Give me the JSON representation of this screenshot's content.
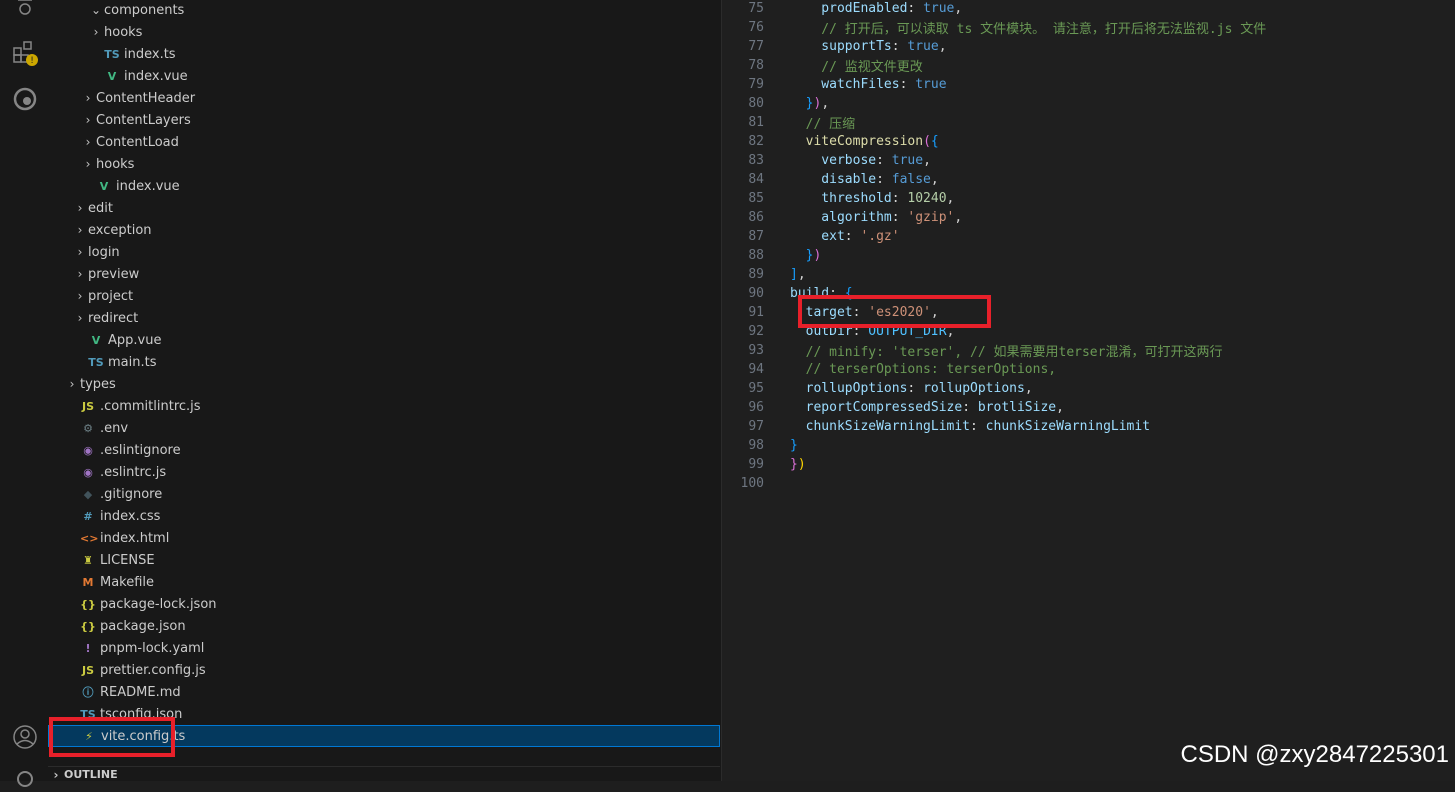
{
  "colors": {
    "keyword": "#9cdcfe",
    "boolean": "#569cd6",
    "string": "#ce9178",
    "number": "#b5cea8",
    "comment": "#6a9955",
    "function": "#dcdcaa",
    "bracket_gold": "#ffd700",
    "bracket_pink": "#da70d6",
    "bracket_blue": "#179fff",
    "variable": "#4fc1ff",
    "plain": "#d4d4d4",
    "highlight": "#e8202a"
  },
  "activity_bar": {
    "icons": [
      "debug-icon",
      "extensions-icon",
      "edge-browser-icon",
      "account-icon",
      "settings-icon"
    ]
  },
  "explorer": {
    "items": [
      {
        "label": "components",
        "chevron": "⌄",
        "icon": "",
        "indent": 4
      },
      {
        "label": "hooks",
        "chevron": "›",
        "icon": "",
        "indent": 4
      },
      {
        "label": "index.ts",
        "chevron": "",
        "icon": "TS",
        "indent": 4
      },
      {
        "label": "index.vue",
        "chevron": "",
        "icon": "V",
        "indent": 4
      },
      {
        "label": "ContentHeader",
        "chevron": "›",
        "icon": "",
        "indent": 3
      },
      {
        "label": "ContentLayers",
        "chevron": "›",
        "icon": "",
        "indent": 3
      },
      {
        "label": "ContentLoad",
        "chevron": "›",
        "icon": "",
        "indent": 3
      },
      {
        "label": "hooks",
        "chevron": "›",
        "icon": "",
        "indent": 3
      },
      {
        "label": "index.vue",
        "chevron": "",
        "icon": "V",
        "indent": 3
      },
      {
        "label": "edit",
        "chevron": "›",
        "icon": "",
        "indent": 2
      },
      {
        "label": "exception",
        "chevron": "›",
        "icon": "",
        "indent": 2
      },
      {
        "label": "login",
        "chevron": "›",
        "icon": "",
        "indent": 2
      },
      {
        "label": "preview",
        "chevron": "›",
        "icon": "",
        "indent": 2
      },
      {
        "label": "project",
        "chevron": "›",
        "icon": "",
        "indent": 2
      },
      {
        "label": "redirect",
        "chevron": "›",
        "icon": "",
        "indent": 2
      },
      {
        "label": "App.vue",
        "chevron": "",
        "icon": "V",
        "indent": 2
      },
      {
        "label": "main.ts",
        "chevron": "",
        "icon": "TS",
        "indent": 2
      },
      {
        "label": "types",
        "chevron": "›",
        "icon": "",
        "indent": 1
      },
      {
        "label": ".commitlintrc.js",
        "chevron": "",
        "icon": "JS",
        "indent": 1
      },
      {
        "label": ".env",
        "chevron": "",
        "icon": "⚙",
        "indent": 1
      },
      {
        "label": ".eslintignore",
        "chevron": "",
        "icon": "◉",
        "indent": 1
      },
      {
        "label": ".eslintrc.js",
        "chevron": "",
        "icon": "◉",
        "indent": 1
      },
      {
        "label": ".gitignore",
        "chevron": "",
        "icon": "◆",
        "indent": 1
      },
      {
        "label": "index.css",
        "chevron": "",
        "icon": "#",
        "indent": 1
      },
      {
        "label": "index.html",
        "chevron": "",
        "icon": "<>",
        "indent": 1
      },
      {
        "label": "LICENSE",
        "chevron": "",
        "icon": "♜",
        "indent": 1
      },
      {
        "label": "Makefile",
        "chevron": "",
        "icon": "M",
        "indent": 1
      },
      {
        "label": "package-lock.json",
        "chevron": "",
        "icon": "{}",
        "indent": 1
      },
      {
        "label": "package.json",
        "chevron": "",
        "icon": "{}",
        "indent": 1
      },
      {
        "label": "pnpm-lock.yaml",
        "chevron": "",
        "icon": "!",
        "indent": 1
      },
      {
        "label": "prettier.config.js",
        "chevron": "",
        "icon": "JS",
        "indent": 1
      },
      {
        "label": "README.md",
        "chevron": "",
        "icon": "ⓘ",
        "indent": 1
      },
      {
        "label": "tsconfig.json",
        "chevron": "",
        "icon": "TS",
        "indent": 1
      },
      {
        "label": "vite.config.ts",
        "chevron": "",
        "icon": "⚡",
        "indent": 1,
        "selected": true
      }
    ],
    "outline_label": "OUTLINE"
  },
  "editor": {
    "lines": [
      {
        "n": "75",
        "tokens": [
          [
            "    prodEnabled",
            "keyword"
          ],
          [
            ": ",
            "plain"
          ],
          [
            "true",
            "boolean"
          ],
          [
            ",",
            "plain"
          ]
        ]
      },
      {
        "n": "76",
        "tokens": [
          [
            "    // 打开后，可以读取 ts 文件模块。 请注意，打开后将无法监视.js 文件",
            "comment"
          ]
        ]
      },
      {
        "n": "77",
        "tokens": [
          [
            "    supportTs",
            "keyword"
          ],
          [
            ": ",
            "plain"
          ],
          [
            "true",
            "boolean"
          ],
          [
            ",",
            "plain"
          ]
        ]
      },
      {
        "n": "78",
        "tokens": [
          [
            "    // 监视文件更改",
            "comment"
          ]
        ]
      },
      {
        "n": "79",
        "tokens": [
          [
            "    watchFiles",
            "keyword"
          ],
          [
            ": ",
            "plain"
          ],
          [
            "true",
            "boolean"
          ]
        ]
      },
      {
        "n": "80",
        "tokens": [
          [
            "  ",
            "plain"
          ],
          [
            "}",
            "bracket_blue"
          ],
          [
            ")",
            "bracket_pink"
          ],
          [
            ",",
            "plain"
          ]
        ]
      },
      {
        "n": "81",
        "tokens": [
          [
            "  // 压缩",
            "comment"
          ]
        ]
      },
      {
        "n": "82",
        "tokens": [
          [
            "  viteCompression",
            "function"
          ],
          [
            "(",
            "bracket_pink"
          ],
          [
            "{",
            "bracket_blue"
          ]
        ]
      },
      {
        "n": "83",
        "tokens": [
          [
            "    verbose",
            "keyword"
          ],
          [
            ": ",
            "plain"
          ],
          [
            "true",
            "boolean"
          ],
          [
            ",",
            "plain"
          ]
        ]
      },
      {
        "n": "84",
        "tokens": [
          [
            "    disable",
            "keyword"
          ],
          [
            ": ",
            "plain"
          ],
          [
            "false",
            "boolean"
          ],
          [
            ",",
            "plain"
          ]
        ]
      },
      {
        "n": "85",
        "tokens": [
          [
            "    threshold",
            "keyword"
          ],
          [
            ": ",
            "plain"
          ],
          [
            "10240",
            "number"
          ],
          [
            ",",
            "plain"
          ]
        ]
      },
      {
        "n": "86",
        "tokens": [
          [
            "    algorithm",
            "keyword"
          ],
          [
            ": ",
            "plain"
          ],
          [
            "'gzip'",
            "string"
          ],
          [
            ",",
            "plain"
          ]
        ]
      },
      {
        "n": "87",
        "tokens": [
          [
            "    ext",
            "keyword"
          ],
          [
            ": ",
            "plain"
          ],
          [
            "'.gz'",
            "string"
          ]
        ]
      },
      {
        "n": "88",
        "tokens": [
          [
            "  ",
            "plain"
          ],
          [
            "}",
            "bracket_blue"
          ],
          [
            ")",
            "bracket_pink"
          ]
        ]
      },
      {
        "n": "89",
        "tokens": [
          [
            "]",
            "bracket_blue"
          ],
          [
            ",",
            "plain"
          ]
        ]
      },
      {
        "n": "90",
        "tokens": [
          [
            "build",
            "keyword"
          ],
          [
            ": ",
            "plain"
          ],
          [
            "{",
            "bracket_blue"
          ]
        ]
      },
      {
        "n": "91",
        "tokens": [
          [
            "  target",
            "keyword"
          ],
          [
            ": ",
            "plain"
          ],
          [
            "'es2020'",
            "string"
          ],
          [
            ",",
            "plain"
          ]
        ]
      },
      {
        "n": "92",
        "tokens": [
          [
            "  outDir",
            "keyword"
          ],
          [
            ": ",
            "plain"
          ],
          [
            "OUTPUT_DIR",
            "variable"
          ],
          [
            ",",
            "plain"
          ]
        ]
      },
      {
        "n": "93",
        "tokens": [
          [
            "  // minify: 'terser', // 如果需要用terser混淆，可打开这两行",
            "comment"
          ]
        ]
      },
      {
        "n": "94",
        "tokens": [
          [
            "  // terserOptions: terserOptions,",
            "comment"
          ]
        ]
      },
      {
        "n": "95",
        "tokens": [
          [
            "  rollupOptions",
            "keyword"
          ],
          [
            ": ",
            "plain"
          ],
          [
            "rollupOptions",
            "keyword"
          ],
          [
            ",",
            "plain"
          ]
        ]
      },
      {
        "n": "96",
        "tokens": [
          [
            "  reportCompressedSize",
            "keyword"
          ],
          [
            ": ",
            "plain"
          ],
          [
            "brotliSize",
            "keyword"
          ],
          [
            ",",
            "plain"
          ]
        ]
      },
      {
        "n": "97",
        "tokens": [
          [
            "  chunkSizeWarningLimit",
            "keyword"
          ],
          [
            ": ",
            "plain"
          ],
          [
            "chunkSizeWarningLimit",
            "keyword"
          ]
        ]
      },
      {
        "n": "98",
        "tokens": [
          [
            "}",
            "bracket_blue"
          ]
        ]
      },
      {
        "n": "99",
        "tokens": [
          [
            "}",
            "bracket_pink"
          ],
          [
            ")",
            "bracket_gold"
          ]
        ]
      },
      {
        "n": "100",
        "tokens": []
      }
    ]
  },
  "watermark": "CSDN @zxy2847225301"
}
